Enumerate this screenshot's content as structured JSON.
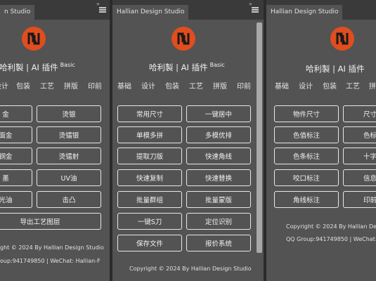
{
  "brand_color": "#e04d1f",
  "panels": [
    {
      "tab": "n Studio",
      "title_main": "哈利製 | AI 插件",
      "title_sup": "Basic",
      "nav": [
        "设计",
        "包装",
        "工艺",
        "拼版",
        "印前"
      ],
      "buttons": [
        "金",
        "烫银",
        "面金",
        "烫镭银",
        "铜金",
        "烫镭射",
        "墨",
        "UV油",
        "光油",
        "击凸",
        "导出工艺图层"
      ],
      "footer1": "ght © 2024 By Hallian Design Studio",
      "footer2": "oup:941749850 | WeChat: Hallian-F"
    },
    {
      "tab": "Hallian Design Studio",
      "title_main": "哈利製 | AI 插件",
      "title_sup": "Basic",
      "nav": [
        "基础",
        "设计",
        "包装",
        "工艺",
        "拼版",
        "印前"
      ],
      "buttons": [
        "常用尺寸",
        "一键居中",
        "单模多拼",
        "多模优排",
        "提取刀版",
        "快速角线",
        "快速复制",
        "快速替换",
        "批量群组",
        "批量蒙版",
        "一键S刀",
        "定位识别",
        "保存文件",
        "报价系统"
      ],
      "footer1": "Copyright © 2024 By Hallian Design Studio"
    },
    {
      "tab": "Hallian Design Studio",
      "title_main": "哈利製 | AI 插件",
      "nav": [
        "基础",
        "设计",
        "包装",
        "工艺",
        "拼版",
        "印"
      ],
      "buttons": [
        "物件尺寸",
        "尺寸",
        "色值标注",
        "色标",
        "色条标注",
        "十字",
        "咬口标注",
        "信息",
        "角线标注",
        "印前"
      ],
      "footer1": "Copyright © 2024 By Hallian Design",
      "footer2": "QQ Group:941749850 | WeChat: H"
    }
  ]
}
